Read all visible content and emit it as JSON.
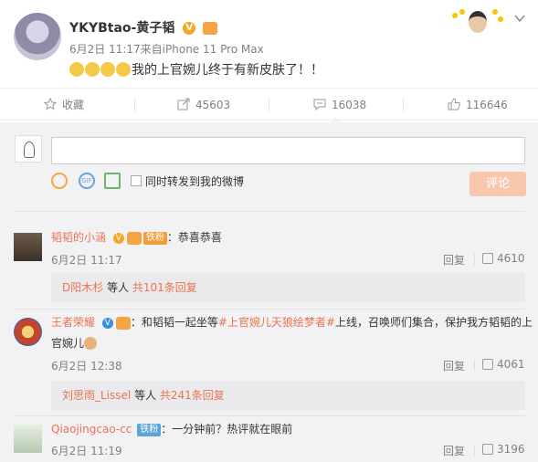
{
  "post": {
    "author": "YKYBtao-黄子韬",
    "date": "6月2日 11:17",
    "source": "来自iPhone 11 Pro Max",
    "text": "我的上官婉儿终于有新皮肤了！！"
  },
  "actions": {
    "favorite": "收藏",
    "repost": "45603",
    "comment": "16038",
    "like": "116646"
  },
  "composer": {
    "checkbox_label": "同时转发到我的微博",
    "submit": "评论"
  },
  "comments": [
    {
      "name": "韬韬的小涵",
      "tag": "铁粉",
      "text": "：恭喜恭喜",
      "time": "6月2日 11:17",
      "reply": "回复",
      "likes": "4610",
      "sub_user": "D阳木杉",
      "sub_mid": " 等人 ",
      "sub_count": "共101条回复"
    },
    {
      "name": "王者荣耀",
      "text_pre": "：和韬韬一起坐等",
      "hashtag": "#上官婉儿天狼绘梦者#",
      "text_post": "上线，召唤师们集合，保护我方韬韬的上",
      "text_line2": "官婉儿",
      "time": "6月2日 12:38",
      "reply": "回复",
      "likes": "4061",
      "sub_user": "刘思雨_Lissel",
      "sub_mid": " 等人 ",
      "sub_count": "共241条回复"
    },
    {
      "name": "Qiaojingcao-cc",
      "tag": "铁粉",
      "text": "：一分钟前？热评就在眼前",
      "time": "6月2日 11:19",
      "reply": "回复",
      "likes": "3196"
    }
  ],
  "colors": {
    "accent": "#eb7350",
    "link_blue": "#eb7350",
    "submit_bg": "#f9c7ae",
    "tag_bg": "#f59e38",
    "background": "#f2f2f5"
  },
  "icons": [
    "smile-icon",
    "gif-icon",
    "image-icon",
    "favorite-icon",
    "repost-icon",
    "comment-icon",
    "like-icon",
    "chevron-down-icon"
  ]
}
